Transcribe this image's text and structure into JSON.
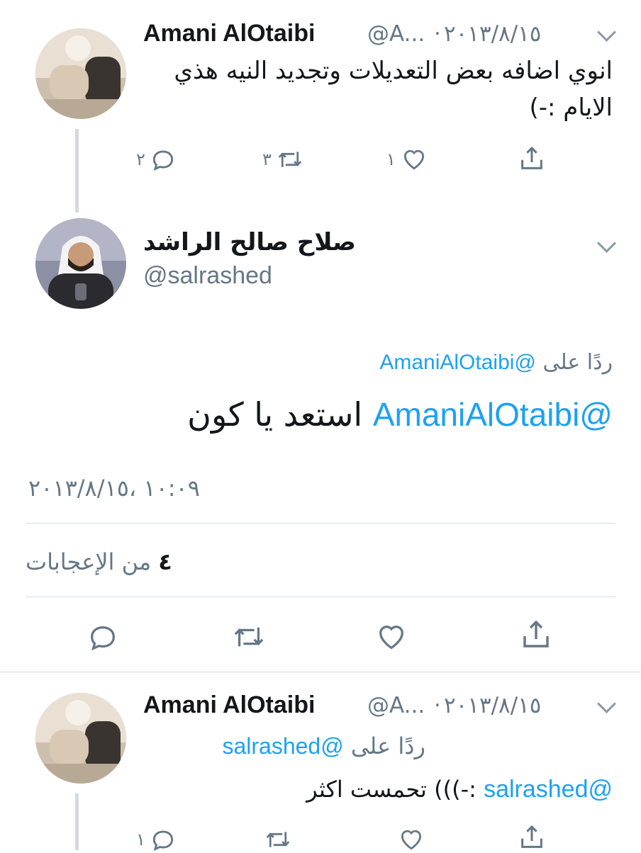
{
  "tweet1": {
    "name": "Amani AlOtaibi",
    "handle": "@A...",
    "date": "٢٠١٣/٨/١٥",
    "separator": "·",
    "text_line1": "انوي اضافه بعض التعديلات وتجديد النيه هذي",
    "text_line2": "الايام :-)",
    "reply_count": "٢",
    "retweet_count": "٣",
    "like_count": "١"
  },
  "main": {
    "name": "صلاح صالح الراشد",
    "handle": "@salrashed",
    "replying_label": "ردًا على",
    "replying_to": "@AmaniAlOtaibi",
    "text_mention": "@AmaniAlOtaibi",
    "text_body": "استعد يا كون",
    "timestamp": "١٠:٠٩ ،٢٠١٣/٨/١٥",
    "likes_count": "٤",
    "likes_label": "من الإعجابات"
  },
  "tweet3": {
    "name": "Amani AlOtaibi",
    "handle": "@A...",
    "date": "٢٠١٣/٨/١٥",
    "separator": "·",
    "replying_label": "ردًا على",
    "replying_to": "@salrashed",
    "text_mention": "@salrashed",
    "text_body": ":-))) تحمست اكثر",
    "reply_count": "١"
  },
  "icons": {
    "reply": "reply-icon",
    "retweet": "retweet-icon",
    "like": "heart-icon",
    "share": "share-icon",
    "more": "chevron-down-icon"
  },
  "colors": {
    "link": "#1da1f2",
    "muted": "#657786",
    "thread_line": "#d3dade"
  }
}
